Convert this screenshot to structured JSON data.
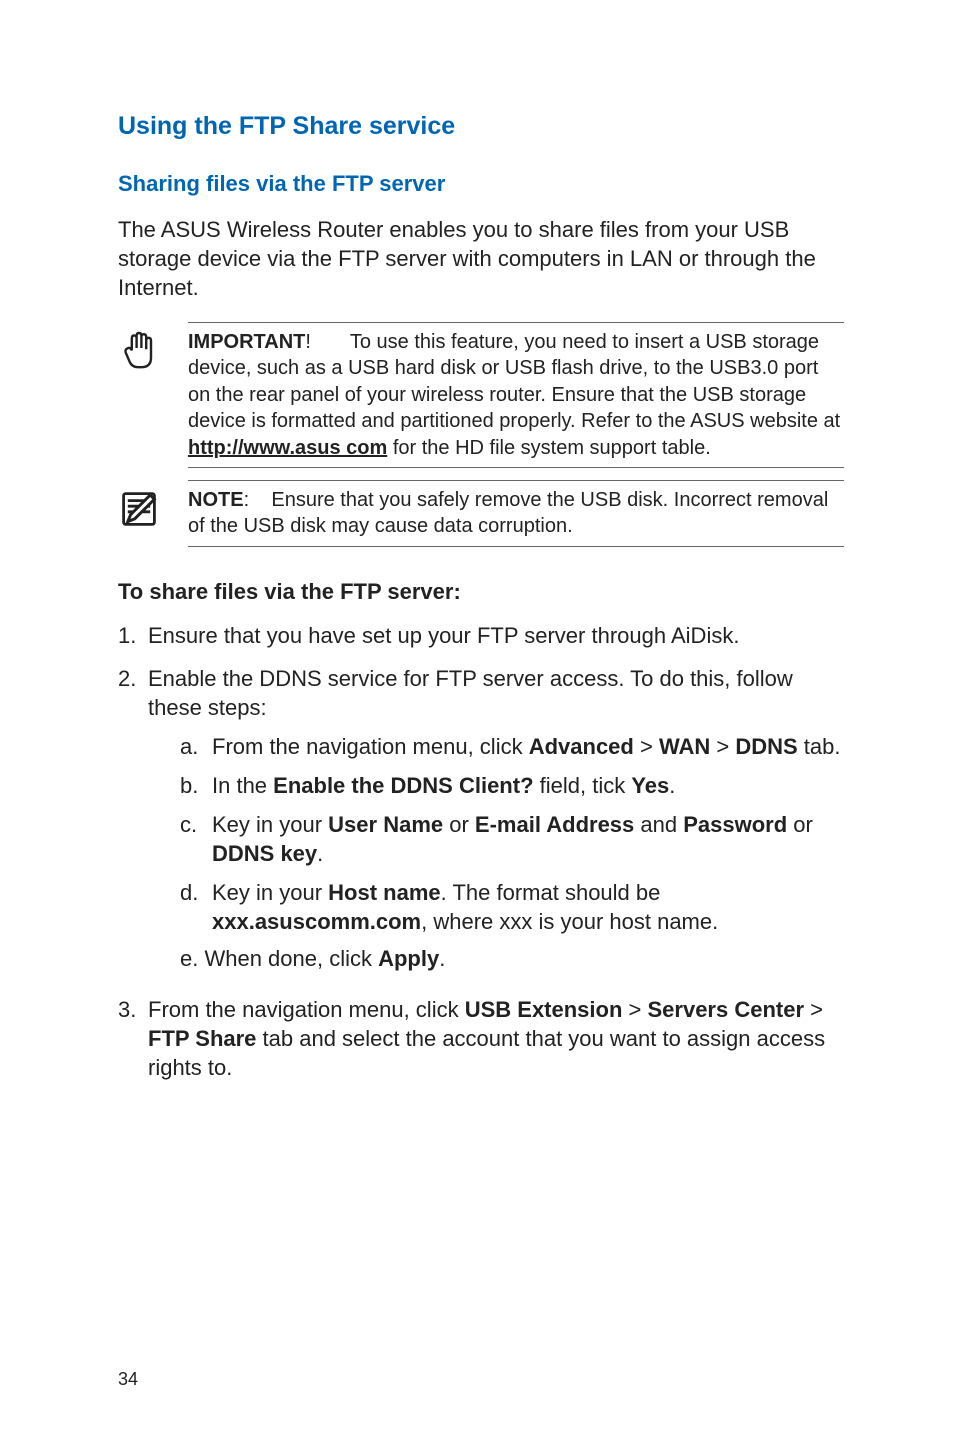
{
  "headings": {
    "section": "Using the FTP Share service",
    "subsection": "Sharing files via the FTP server",
    "steps": "To share files via the FTP server:"
  },
  "intro_para": "The ASUS Wireless Router enables you to share files from your USB storage device via the FTP server with computers in LAN or through the Internet.",
  "important": {
    "label": "IMPORTANT",
    "punct": "!",
    "body_before_link": "To use this feature, you need to insert a USB storage device, such as a USB hard disk or USB  flash drive, to the USB3.0 port on the rear panel of your wireless router. Ensure that the USB storage device is formatted and partitioned properly. Refer to the ASUS website at ",
    "link_text": "http://www.asus com",
    "body_after_link": " for the HD file system support table."
  },
  "note": {
    "label": "NOTE",
    "punct": ":",
    "body": "Ensure that you safely remove the USB disk. Incorrect removal of the USB disk may cause data corruption."
  },
  "steps": {
    "s1": {
      "num": "1.",
      "text": "Ensure that you have set up your FTP server through AiDisk."
    },
    "s2": {
      "num": "2.",
      "text": "Enable the DDNS service for FTP server access. To do this, follow these steps:",
      "a": {
        "num": "a.",
        "pre": "From the navigation menu, click ",
        "b1": "Advanced",
        "sep1": " > ",
        "b2": "WAN",
        "sep2": " > ",
        "b3": "DDNS",
        "post": " tab."
      },
      "b": {
        "num": "b.",
        "pre": "In the ",
        "b1": "Enable the DDNS Client?",
        "mid": " field, tick ",
        "b2": "Yes",
        "post": "."
      },
      "c": {
        "num": "c.",
        "pre": "Key in your ",
        "b1": "User Name",
        "mid1": " or ",
        "b2": "E-mail Address",
        "mid2": " and ",
        "b3": "Password",
        "mid3": " or ",
        "b4": "DDNS key",
        "post": "."
      },
      "d": {
        "num": "d.",
        "pre": "Key in your ",
        "b1": "Host name",
        "mid": ". The format should be ",
        "b2": "xxx.asuscomm.com",
        "post": ", where xxx is your host name."
      },
      "e": {
        "pre": "e. When done, click ",
        "b1": "Apply",
        "post": "."
      }
    },
    "s3": {
      "num": "3.",
      "pre": "From the navigation menu, click ",
      "b1": "USB Extension",
      "sep1": " > ",
      "b2": "Servers Center",
      "sep2": " > ",
      "b3": "FTP Share",
      "post": " tab and select the account that you want to assign access rights to."
    }
  },
  "page_number": "34"
}
